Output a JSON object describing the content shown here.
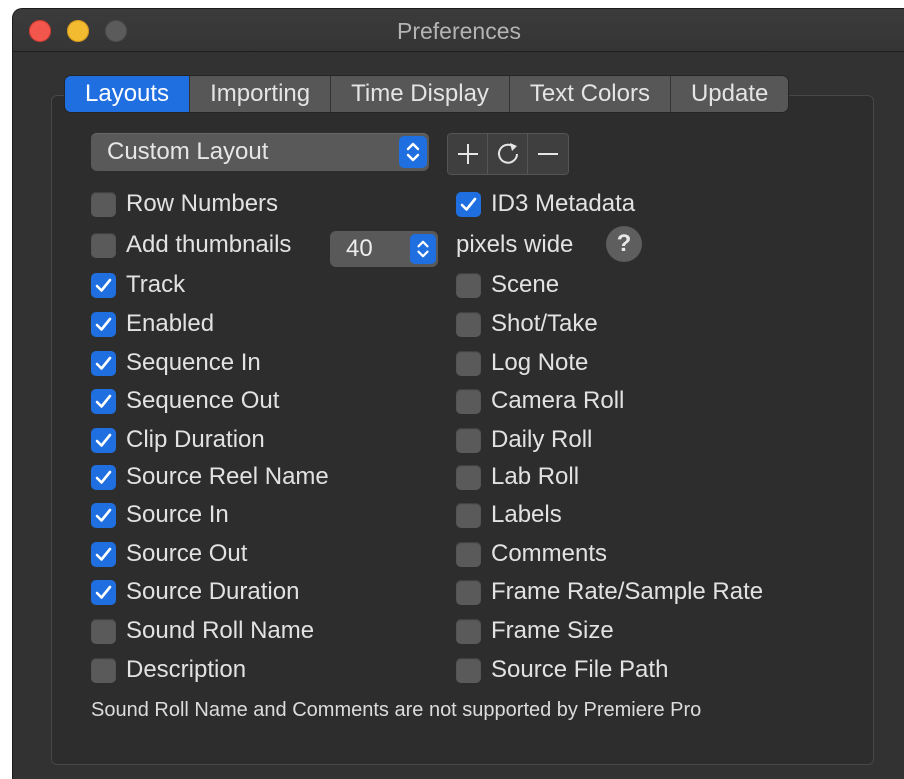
{
  "window": {
    "title": "Preferences"
  },
  "tabs": [
    {
      "label": "Layouts",
      "active": true
    },
    {
      "label": "Importing",
      "active": false
    },
    {
      "label": "Time Display",
      "active": false
    },
    {
      "label": "Text Colors",
      "active": false
    },
    {
      "label": "Update",
      "active": false
    }
  ],
  "layout_select": {
    "value": "Custom Layout"
  },
  "layout_buttons": {
    "add": "+",
    "reset": "reset-icon",
    "remove": "−"
  },
  "thumbnail_width": {
    "value": "40",
    "unit_label": "pixels wide",
    "help": "?"
  },
  "left_column": [
    {
      "label": "Row Numbers",
      "checked": false
    },
    {
      "label": "Add thumbnails",
      "checked": false
    },
    {
      "label": "Track",
      "checked": true
    },
    {
      "label": "Enabled",
      "checked": true
    },
    {
      "label": "Sequence In",
      "checked": true
    },
    {
      "label": "Sequence Out",
      "checked": true
    },
    {
      "label": "Clip Duration",
      "checked": true
    },
    {
      "label": "Source Reel Name",
      "checked": true
    },
    {
      "label": "Source In",
      "checked": true
    },
    {
      "label": "Source Out",
      "checked": true
    },
    {
      "label": "Source Duration",
      "checked": true
    },
    {
      "label": "Sound Roll Name",
      "checked": false
    },
    {
      "label": "Description",
      "checked": false
    }
  ],
  "right_column": [
    {
      "label": "ID3 Metadata",
      "checked": true
    },
    {
      "label": "Scene",
      "checked": false
    },
    {
      "label": "Shot/Take",
      "checked": false
    },
    {
      "label": "Log Note",
      "checked": false
    },
    {
      "label": "Camera Roll",
      "checked": false
    },
    {
      "label": "Daily Roll",
      "checked": false
    },
    {
      "label": "Lab Roll",
      "checked": false
    },
    {
      "label": "Labels",
      "checked": false
    },
    {
      "label": "Comments",
      "checked": false
    },
    {
      "label": "Frame Rate/Sample Rate",
      "checked": false
    },
    {
      "label": "Frame Size",
      "checked": false
    },
    {
      "label": "Source File Path",
      "checked": false
    }
  ],
  "note": "Sound Roll Name and Comments are not supported by Premiere Pro",
  "colors": {
    "accent": "#1f6fe0",
    "window_bg": "#323232",
    "control_bg": "#595959"
  }
}
